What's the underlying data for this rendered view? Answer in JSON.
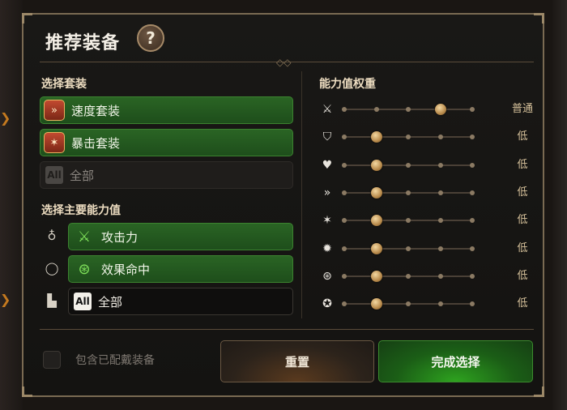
{
  "dialog": {
    "title": "推荐装备",
    "help_label": "?"
  },
  "set_section": {
    "label": "选择套装",
    "options": [
      {
        "label": "速度套装",
        "icon": "speed-set-icon",
        "selected": true
      },
      {
        "label": "暴击套装",
        "icon": "critical-set-icon",
        "selected": true
      },
      {
        "label": "全部",
        "icon_text": "All",
        "selected": false
      }
    ]
  },
  "main_stat_section": {
    "label": "选择主要能力值",
    "rows": [
      {
        "slot_icon": "necklace-icon",
        "label": "攻击力",
        "stat_icon": "sword-icon",
        "selected": true
      },
      {
        "slot_icon": "ring-icon",
        "label": "效果命中",
        "stat_icon": "effectiveness-icon",
        "selected": true
      },
      {
        "slot_icon": "boots-icon",
        "label": "全部",
        "icon_text": "All",
        "selected": false
      }
    ]
  },
  "weights_section": {
    "label": "能力值权重",
    "rows": [
      {
        "stat_icon": "attack-icon",
        "level": 3,
        "max": 4,
        "value_label": "普通"
      },
      {
        "stat_icon": "defense-icon",
        "level": 1,
        "max": 4,
        "value_label": "低"
      },
      {
        "stat_icon": "health-icon",
        "level": 1,
        "max": 4,
        "value_label": "低"
      },
      {
        "stat_icon": "speed-icon",
        "level": 1,
        "max": 4,
        "value_label": "低"
      },
      {
        "stat_icon": "crit-chance-icon",
        "level": 1,
        "max": 4,
        "value_label": "低"
      },
      {
        "stat_icon": "crit-damage-icon",
        "level": 1,
        "max": 4,
        "value_label": "低"
      },
      {
        "stat_icon": "effectiveness-icon",
        "level": 1,
        "max": 4,
        "value_label": "低"
      },
      {
        "stat_icon": "effect-resistance-icon",
        "level": 1,
        "max": 4,
        "value_label": "低"
      }
    ]
  },
  "footer": {
    "include_equipped_label": "包含已配戴装备",
    "include_equipped_checked": false,
    "reset_label": "重置",
    "done_label": "完成选择"
  },
  "colors": {
    "selected_green": "#2a6424",
    "accent_gold": "#b88a4b",
    "frame_border": "#7a6a52"
  }
}
